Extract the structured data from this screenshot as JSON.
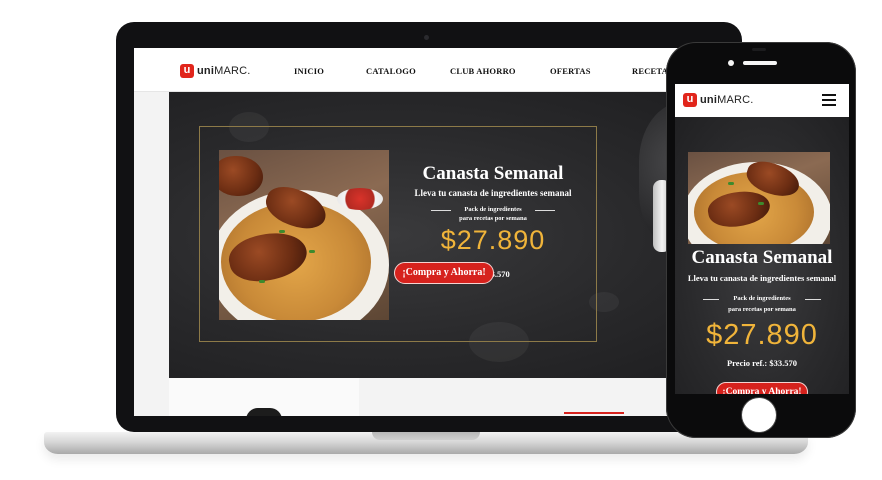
{
  "brand": {
    "logo_mark": "u",
    "logo_text_bold": "uni",
    "logo_text_rest": "MARC."
  },
  "nav": {
    "items": [
      "INICIO",
      "CATALOGO",
      "CLUB AHORRO",
      "OFERTAS",
      "RECETAS"
    ]
  },
  "promo": {
    "title": "Canasta Semanal",
    "subtitle": "Lleva tu canasta de ingredientes semanal",
    "pack_line1": "Pack de ingredientes",
    "pack_line2": "para recetas por semana",
    "price": "$27.890",
    "ref_price_partial": ".: $33.570",
    "ref_price": "Precio ref.: $33.570",
    "cta": "¡Compra y Ahorra!"
  },
  "colors": {
    "brand_red": "#e1251b",
    "price_gold": "#f0b43a",
    "cta_red": "#d6221d",
    "frame_gold": "#8d7a48"
  },
  "icons": {
    "menu": "hamburger-menu-icon"
  }
}
